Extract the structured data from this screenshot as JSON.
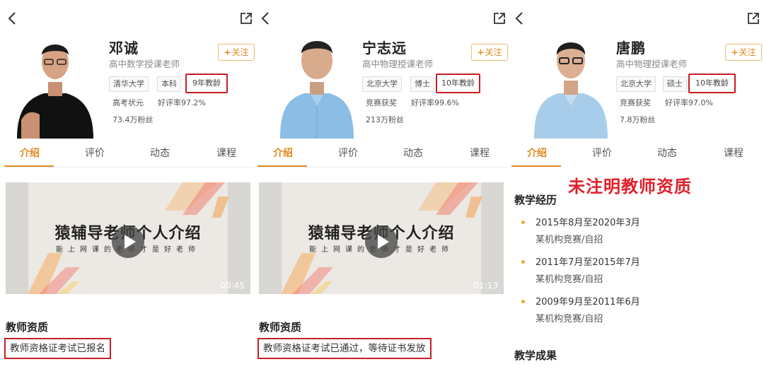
{
  "panels": [
    {
      "name": "邓诚",
      "subtitle": "高中数学授课老师",
      "follow_label": "关注",
      "tags": [
        "清华大学",
        "本科",
        "9年教龄",
        "高考状元",
        "好评率97.2%",
        "73.4万粉丝"
      ],
      "highlighted_tag": "9年教龄",
      "tabs": [
        "介绍",
        "评价",
        "动态",
        "课程"
      ],
      "active_tab": "介绍",
      "video": {
        "title": "猿辅导老师个人介绍",
        "subtitle": "能上网课的老师才是好老师",
        "duration": "00:45"
      },
      "qualification_heading": "教师资质",
      "qualification_text": "教师资格证考试已报名"
    },
    {
      "name": "宁志远",
      "subtitle": "高中物理授课老师",
      "follow_label": "关注",
      "tags": [
        "北京大学",
        "博士",
        "10年教龄",
        "竞赛获奖",
        "好评率99.6%",
        "213万粉丝"
      ],
      "highlighted_tag": "10年教龄",
      "tabs": [
        "介绍",
        "评价",
        "动态",
        "课程"
      ],
      "active_tab": "介绍",
      "video": {
        "title": "猿辅导老师个人介绍",
        "subtitle": "能上网课的老师才是好老师",
        "duration": "01:13"
      },
      "qualification_heading": "教师资质",
      "qualification_text": "教师资格证考试已通过，等待证书发放"
    },
    {
      "name": "唐鹏",
      "subtitle": "高中物理授课老师",
      "follow_label": "关注",
      "tags": [
        "北京大学",
        "硕士",
        "10年教龄",
        "竞赛获奖",
        "好评率97.0%",
        "7.8万粉丝"
      ],
      "highlighted_tag": "10年教龄",
      "tabs": [
        "介绍",
        "评价",
        "动态",
        "课程"
      ],
      "active_tab": "介绍",
      "callout": "未注明教师资质",
      "experience_heading": "教学经历",
      "experience": [
        {
          "period": "2015年8月至2020年3月",
          "org": "某机构竞赛/自招"
        },
        {
          "period": "2011年7月至2015年7月",
          "org": "某机构竞赛/自招"
        },
        {
          "period": "2009年9月至2011年6月",
          "org": "某机构竞赛/自招"
        }
      ],
      "achievements_heading": "教学成果"
    }
  ],
  "colors": {
    "accent": "#e08a1e",
    "highlight_border": "#c81d25",
    "callout": "#e0202a"
  },
  "icons": [
    "back-chevron-icon",
    "share-icon",
    "plus-icon",
    "play-icon"
  ]
}
